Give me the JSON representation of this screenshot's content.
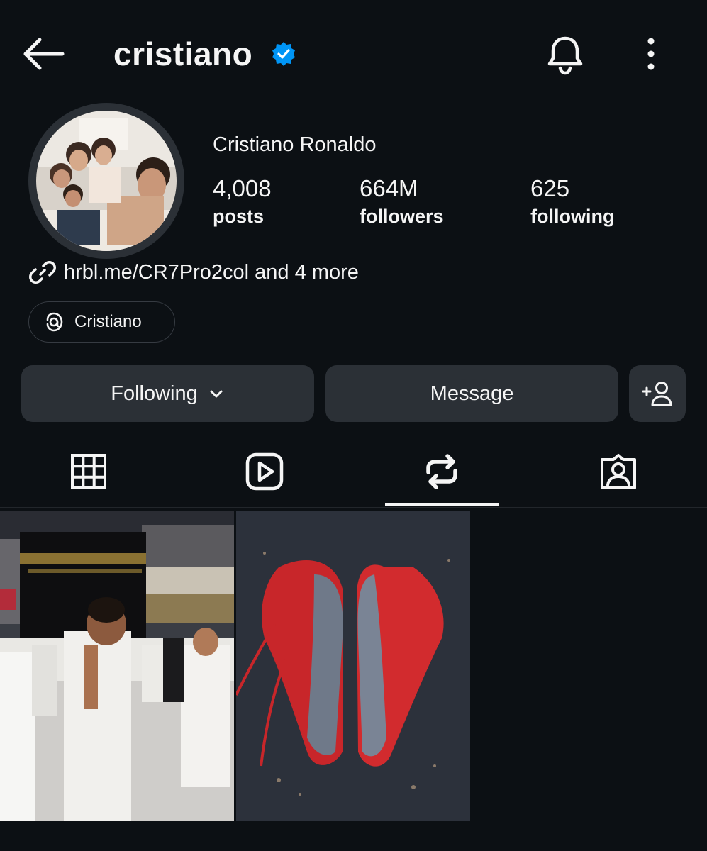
{
  "header": {
    "username": "cristiano",
    "icons": {
      "back": "arrow-left-icon",
      "verified": "verified-badge-icon",
      "notifications": "bell-icon",
      "more": "more-vertical-icon"
    }
  },
  "profile": {
    "full_name": "Cristiano Ronaldo",
    "stats": [
      {
        "value": "4,008",
        "label": "posts"
      },
      {
        "value": "664M",
        "label": "followers"
      },
      {
        "value": "625",
        "label": "following"
      }
    ],
    "link_text": "hrbl.me/CR7Pro2col and 4 more",
    "threads_label": "Cristiano"
  },
  "actions": {
    "following_label": "Following",
    "message_label": "Message"
  },
  "tabs": [
    "grid-icon",
    "reels-icon",
    "reposts-icon",
    "tagged-icon"
  ],
  "active_tab": "reposts-icon",
  "colors": {
    "background": "#0c1014",
    "button": "#2b3036",
    "verified": "#0095f6",
    "text": "#f5f5f5"
  }
}
